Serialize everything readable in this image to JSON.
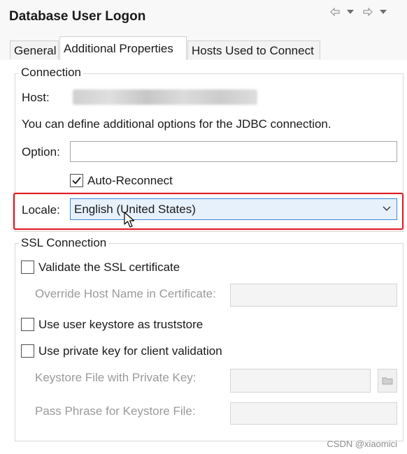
{
  "window": {
    "title": "Database User Logon"
  },
  "tabs": [
    {
      "label": "General",
      "active": false
    },
    {
      "label": "Additional Properties",
      "active": true
    },
    {
      "label": "Hosts Used to Connect",
      "active": false
    }
  ],
  "connection": {
    "legend": "Connection",
    "host_label": "Host:",
    "description": "You can define additional options for the JDBC connection.",
    "option_label": "Option:",
    "option_value": "",
    "auto_reconnect_label": "Auto-Reconnect",
    "auto_reconnect_checked": true,
    "locale_label": "Locale:",
    "locale_value": "English (United States)"
  },
  "ssl": {
    "legend": "SSL Connection",
    "validate_label": "Validate the SSL certificate",
    "validate_checked": false,
    "override_host_label": "Override Host Name in Certificate:",
    "override_host_value": "",
    "keystore_truststore_label": "Use user keystore as truststore",
    "keystore_truststore_checked": false,
    "private_key_label": "Use private key for client validation",
    "private_key_checked": false,
    "keystore_file_label": "Keystore File with Private Key:",
    "keystore_file_value": "",
    "pass_phrase_label": "Pass Phrase for Keystore File:",
    "pass_phrase_value": ""
  },
  "watermark": "CSDN @xiaomici",
  "colors": {
    "highlight": "#e01e24",
    "select_border": "#3a86d4",
    "select_background": "#e7f1fb"
  }
}
